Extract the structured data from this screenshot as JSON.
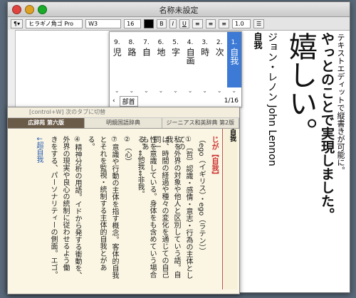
{
  "window": {
    "title": "名称未設定"
  },
  "toolbar": {
    "font": "ヒラギノ角ゴ Pro",
    "weight": "W3",
    "size": "16",
    "bold": "B",
    "italic": "I",
    "underline": "U",
    "spacing": "1.0"
  },
  "doc": {
    "line_big": "嬉しい。",
    "line_bold": "やっとのことで実現しました。",
    "line_small": "テキストエディットで縦書きが可能に。",
    "line_name": "ジョン・レノン John Lennon",
    "line_dict": "自我"
  },
  "candidates": {
    "items": [
      {
        "num": "1.",
        "text": "自我"
      },
      {
        "num": "2.",
        "text": "次"
      },
      {
        "num": "3.",
        "text": "時"
      },
      {
        "num": "4.",
        "text": "自画"
      },
      {
        "num": "5.",
        "text": "字"
      },
      {
        "num": "6.",
        "text": "地"
      },
      {
        "num": "7.",
        "text": "自"
      },
      {
        "num": "8.",
        "text": "路"
      },
      {
        "num": "9.",
        "text": "児"
      }
    ],
    "tag": "部首",
    "page": "1/16"
  },
  "dictionary": {
    "hint": "[control+W] 次のタブに切替",
    "tabs": [
      "広辞苑 第六版",
      "明鏡国語辞典",
      "ジーニアス和英辞典 第2版"
    ],
    "headword": "自我",
    "lines": [
      "じが【自我】",
      "（ego（イギリス）・ego（ラテン））",
      "①〔哲〕認識・感情・意志・行為の主体としての",
      "私を外界の対象や他人と区別していう語。自我",
      "は、時間の経過や種々の変化を通じての自己同一",
      "性を意識している。身体をも含めていう場合もあ",
      "る。⇔他我⇔非我。",
      "②（心）",
      "⑦意識や行動の主体を指す概念。客体的自我",
      "とそれを監視・統制する主体的自我とがあ",
      "る。",
      "④精神分析の用語。イドから発する衝動を、",
      "外界の現実や良心の統制に従わせるよう働",
      "きをする、パーソナリティーの側面。エゴ。",
      "↓超自我"
    ]
  }
}
